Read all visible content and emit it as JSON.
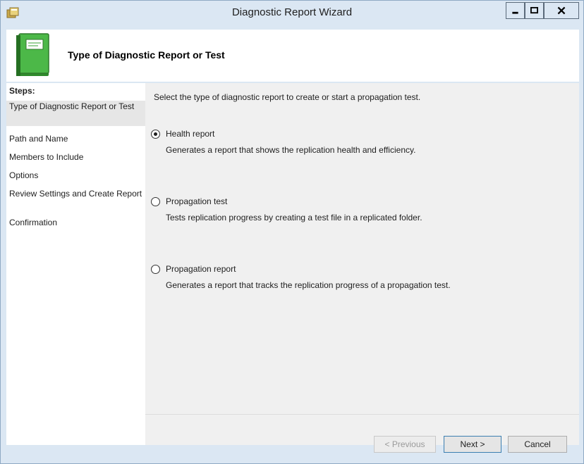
{
  "window": {
    "title": "Diagnostic Report Wizard",
    "controls": {
      "minimize": "minimize-icon",
      "maximize": "maximize-icon",
      "close": "close-icon"
    }
  },
  "header": {
    "title": "Type of Diagnostic Report or Test",
    "icon": "green-book-icon"
  },
  "steps": {
    "title": "Steps:",
    "items": [
      {
        "label": "Type of Diagnostic Report or Test",
        "active": true
      },
      {
        "label": "Path and Name",
        "active": false
      },
      {
        "label": "Members to Include",
        "active": false
      },
      {
        "label": "Options",
        "active": false
      },
      {
        "label": "Review Settings and Create Report",
        "active": false
      },
      {
        "label": "Confirmation",
        "active": false
      }
    ]
  },
  "main": {
    "intro": "Select the type of diagnostic report to create or start a propagation test.",
    "options": [
      {
        "label": "Health report",
        "description": "Generates a report that shows the replication health and efficiency.",
        "selected": true
      },
      {
        "label": "Propagation test",
        "description": "Tests replication progress by creating a test file in a replicated folder.",
        "selected": false
      },
      {
        "label": "Propagation report",
        "description": "Generates a report that tracks the replication progress of a propagation test.",
        "selected": false
      }
    ]
  },
  "buttons": {
    "previous": "< Previous",
    "next": "Next >",
    "cancel": "Cancel"
  },
  "colors": {
    "frame": "#dbe7f3",
    "accent_green": "#3ea33a",
    "focus_border": "#3c7fb1"
  }
}
